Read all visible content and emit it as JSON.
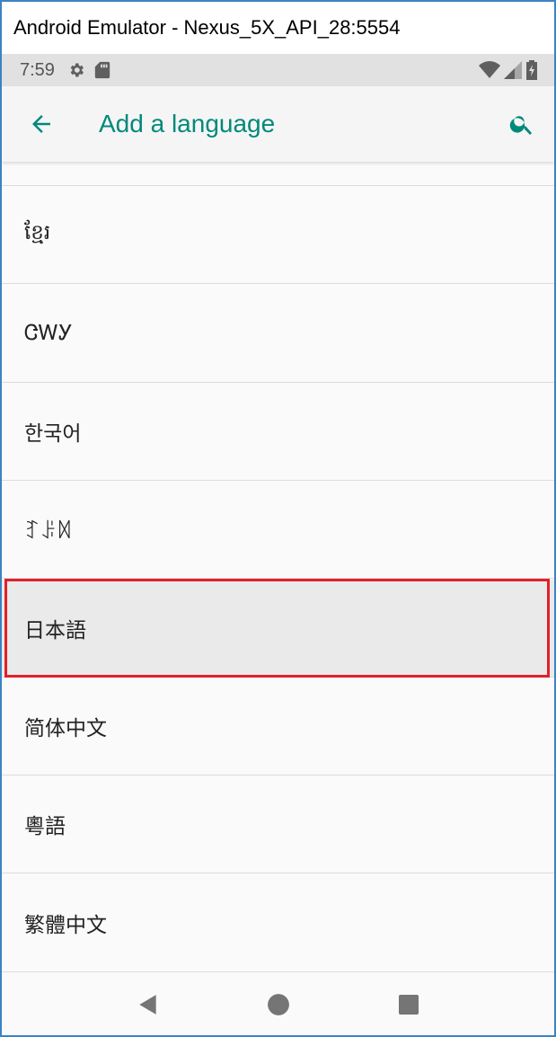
{
  "window": {
    "title": "Android Emulator - Nexus_5X_API_28:5554"
  },
  "status_bar": {
    "time": "7:59",
    "icons_left": [
      "gear-icon",
      "sd-card-icon"
    ],
    "icons_right": [
      "wifi-icon",
      "cell-signal-icon",
      "battery-icon"
    ]
  },
  "app_bar": {
    "title": "Add a language",
    "back_icon": "arrow-back-icon",
    "search_icon": "search-icon",
    "accent_color": "#00897b"
  },
  "languages": [
    {
      "label": "ខ្មែរ"
    },
    {
      "label": "ᏣᎳᎩ"
    },
    {
      "label": "한국어"
    },
    {
      "label": "ꆈꌠꉙ"
    },
    {
      "label": "日本語",
      "pressed": true
    },
    {
      "label": "简体中文"
    },
    {
      "label": "粵語"
    },
    {
      "label": "繁體中文"
    }
  ],
  "nav_bar": {
    "icons": [
      "back-triangle-icon",
      "home-circle-icon",
      "recents-square-icon"
    ]
  },
  "highlight_color": "#e2202b"
}
